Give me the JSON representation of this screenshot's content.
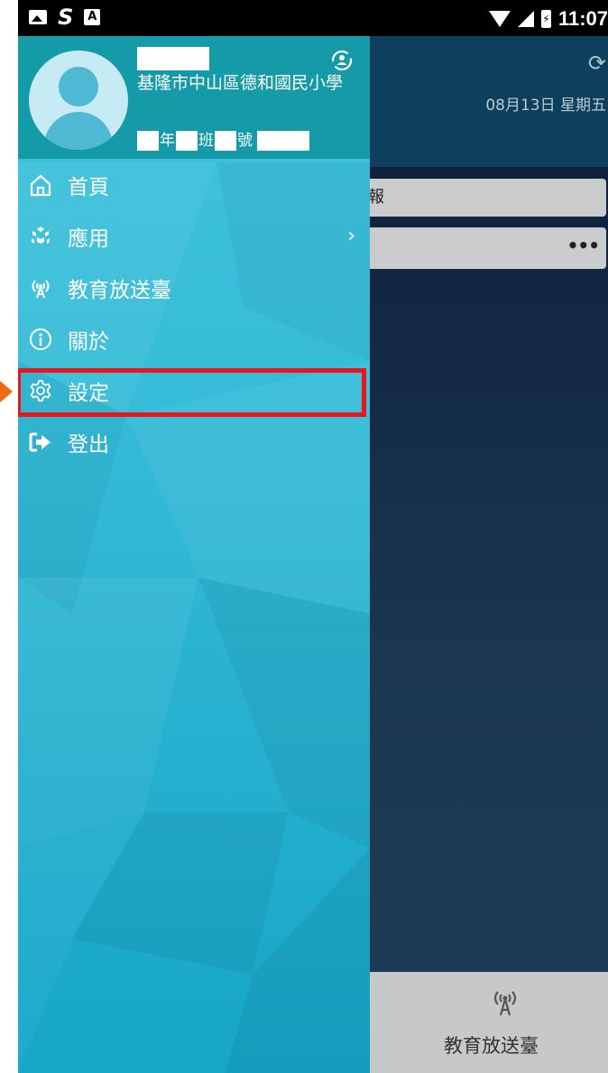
{
  "status_bar": {
    "time": "11:07",
    "letter_s": "S",
    "letter_a": "A"
  },
  "background_app": {
    "date": "08月13日 星期五",
    "card_partial_text": "報",
    "more_label": "•••",
    "tab_label": "教育放送臺"
  },
  "drawer": {
    "school": "基隆市中山區德和國民小學",
    "class_line": {
      "grade_suffix": "年",
      "class_suffix": "班",
      "number_suffix": "號"
    },
    "menu": [
      {
        "label": "首頁",
        "icon": "home-icon"
      },
      {
        "label": "應用",
        "icon": "apps-icon",
        "has_chevron": true
      },
      {
        "label": "教育放送臺",
        "icon": "broadcast-icon"
      },
      {
        "label": "關於",
        "icon": "info-icon"
      },
      {
        "label": "設定",
        "icon": "gear-icon",
        "highlighted": true
      },
      {
        "label": "登出",
        "icon": "logout-icon"
      }
    ]
  },
  "colors": {
    "drawer_header": "#159aa7",
    "drawer_body": "#36bcd8",
    "highlight": "#e8171d",
    "pointer": "#f06a12"
  }
}
